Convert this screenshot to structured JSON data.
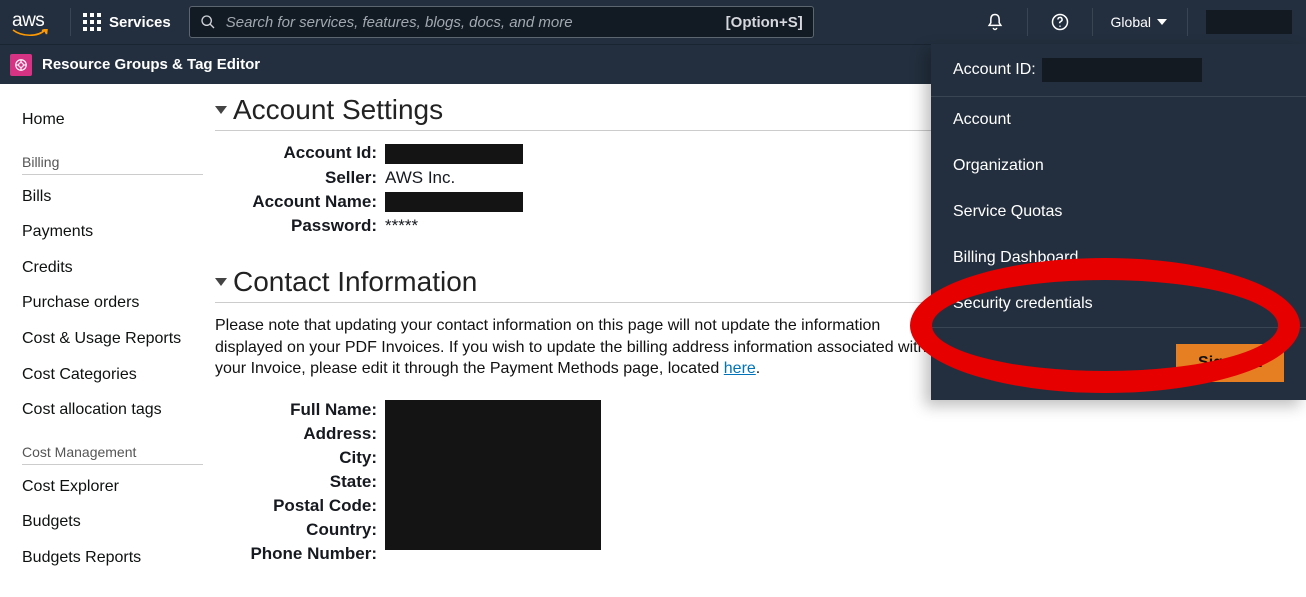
{
  "topnav": {
    "logo_text": "aws",
    "services_label": "Services",
    "search_placeholder": "Search for services, features, blogs, docs, and more",
    "search_shortcut": "[Option+S]",
    "region_label": "Global"
  },
  "secbar": {
    "title": "Resource Groups & Tag Editor"
  },
  "sidebar": {
    "home": "Home",
    "section_billing": "Billing",
    "billing_items": [
      "Bills",
      "Payments",
      "Credits",
      "Purchase orders",
      "Cost & Usage Reports",
      "Cost Categories",
      "Cost allocation tags"
    ],
    "section_cm": "Cost Management",
    "cm_items": [
      "Cost Explorer",
      "Budgets",
      "Budgets Reports"
    ]
  },
  "page": {
    "section1_title": "Account Settings",
    "acct": {
      "account_id_label": "Account Id:",
      "seller_label": "Seller:",
      "seller_value": "AWS Inc.",
      "account_name_label": "Account Name:",
      "password_label": "Password:",
      "password_value": "*****"
    },
    "section2_title": "Contact Information",
    "contact_note_pre": "Please note that updating your contact information on this page will not update the information displayed on your PDF Invoices. If you wish to update the billing address information associated with your Invoice, please edit it through the Payment Methods page, located ",
    "contact_note_link": "here",
    "contact_note_post": ".",
    "contact": {
      "full_name_label": "Full Name:",
      "address_label": "Address:",
      "city_label": "City:",
      "state_label": "State:",
      "postal_label": "Postal Code:",
      "country_label": "Country:",
      "phone_label": "Phone Number:"
    }
  },
  "acct_menu": {
    "account_id_label": "Account ID:",
    "items": [
      "Account",
      "Organization",
      "Service Quotas",
      "Billing Dashboard",
      "Security credentials"
    ],
    "signout_label": "Sign out"
  }
}
